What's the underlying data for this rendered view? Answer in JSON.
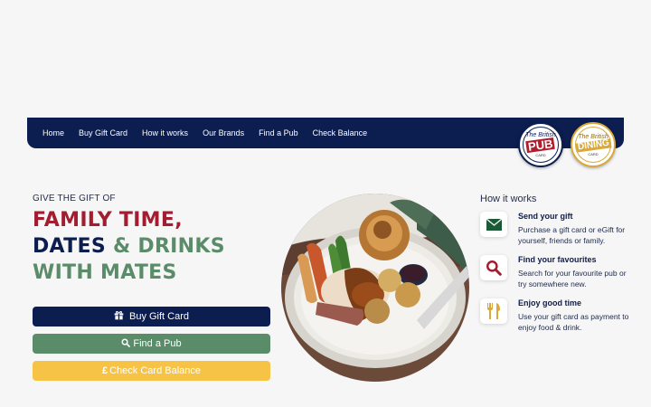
{
  "nav": {
    "items": [
      "Home",
      "Buy Gift Card",
      "How it works",
      "Our Brands",
      "Find a Pub",
      "Check Balance"
    ]
  },
  "logos": {
    "pub": {
      "top": "The British",
      "main": "PUB",
      "bottom": "CARD"
    },
    "dining": {
      "top": "The British",
      "main": "DINING",
      "bottom": "CARD"
    }
  },
  "hero": {
    "eyebrow": "GIVE THE GIFT OF",
    "line1": "FAMILY TIME,",
    "line2_a": "DATES",
    "line2_b": "& DRINKS",
    "line3": "WITH MATES"
  },
  "buttons": {
    "buy": "Buy Gift Card",
    "find": "Find a Pub",
    "check": "Check Card Balance"
  },
  "how_it_works": {
    "title": "How it works",
    "steps": [
      {
        "icon": "envelope-icon",
        "title": "Send your gift",
        "desc": "Purchase a gift card or eGift for yourself, friends or family."
      },
      {
        "icon": "search-icon",
        "title": "Find your favourites",
        "desc": "Search for your favourite pub or try somewhere new."
      },
      {
        "icon": "fork-knife-icon",
        "title": "Enjoy good time",
        "desc": "Use your gift card as payment to enjoy food & drink."
      }
    ]
  },
  "colors": {
    "navy": "#0c1d50",
    "red": "#a21d2f",
    "green": "#5b8c69",
    "yellow": "#f6c346",
    "gold": "#d9a93a"
  }
}
